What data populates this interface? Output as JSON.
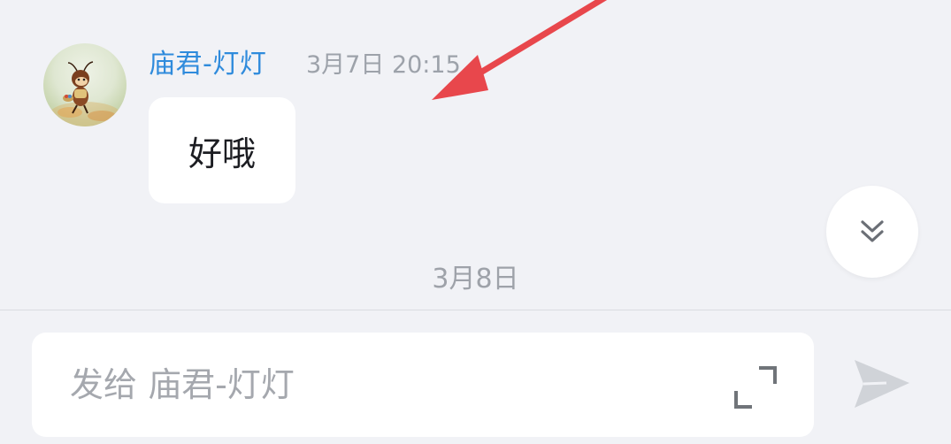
{
  "message": {
    "sender": "庙君-灯灯",
    "timestamp": "3月7日 20:15",
    "text": "好哦",
    "avatar_icon": "avatar-cartoon-ant"
  },
  "date_divider": "3月8日",
  "composer": {
    "placeholder": "发给 庙君-灯灯",
    "expand_icon": "expand-icon",
    "send_icon": "send-icon"
  },
  "scroll_to_bottom_icon": "double-chevron-down-icon",
  "colors": {
    "background": "#f1f2f6",
    "sender_name": "#2f8bdc",
    "annotation_arrow": "#e8474c",
    "bubble": "#ffffff"
  }
}
